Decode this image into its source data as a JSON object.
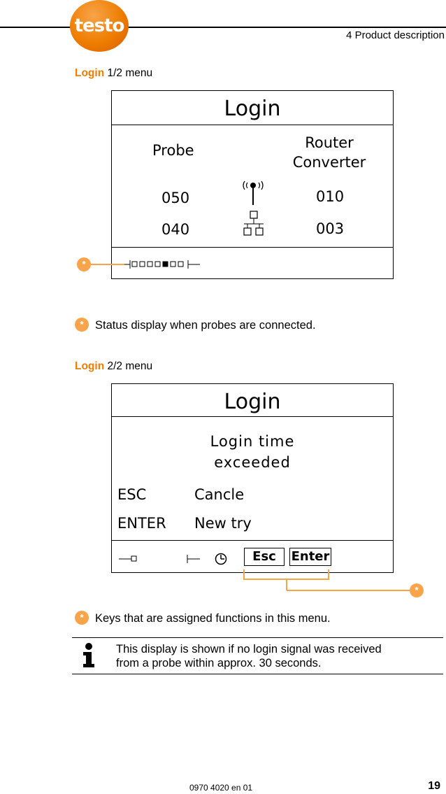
{
  "header": {
    "logo_text": "testo",
    "section": "4 Product description"
  },
  "login1": {
    "heading_bold": "Login",
    "heading_rest": " 1/2 menu",
    "screen_title": "Login",
    "col_left": "Probe",
    "col_right_line1": "Router",
    "col_right_line2": "Converter",
    "row1_left": "050",
    "row1_right": "010",
    "row2_left": "040",
    "row2_right": "003",
    "callout_marker": "*",
    "note": "Status display when probes are connected."
  },
  "login2": {
    "heading_bold": "Login",
    "heading_rest": " 2/2 menu",
    "screen_title": "Login",
    "message_line1": "Login time",
    "message_line2": "exceeded",
    "row1_key": "ESC",
    "row1_action": "Cancle",
    "row2_key": "ENTER",
    "row2_action": "New try",
    "softkey_esc": "Esc",
    "softkey_enter": "Enter",
    "callout_marker": "*",
    "note": "Keys that are assigned functions in this menu."
  },
  "info": {
    "line1": "This display is shown if no login signal was received",
    "line2": "from a probe within approx. 30 seconds."
  },
  "footer": {
    "doc_number": "0970 4020 en 01",
    "page_number": "19"
  },
  "colors": {
    "accent": "#ef7d00",
    "star": "#f7a44a"
  }
}
